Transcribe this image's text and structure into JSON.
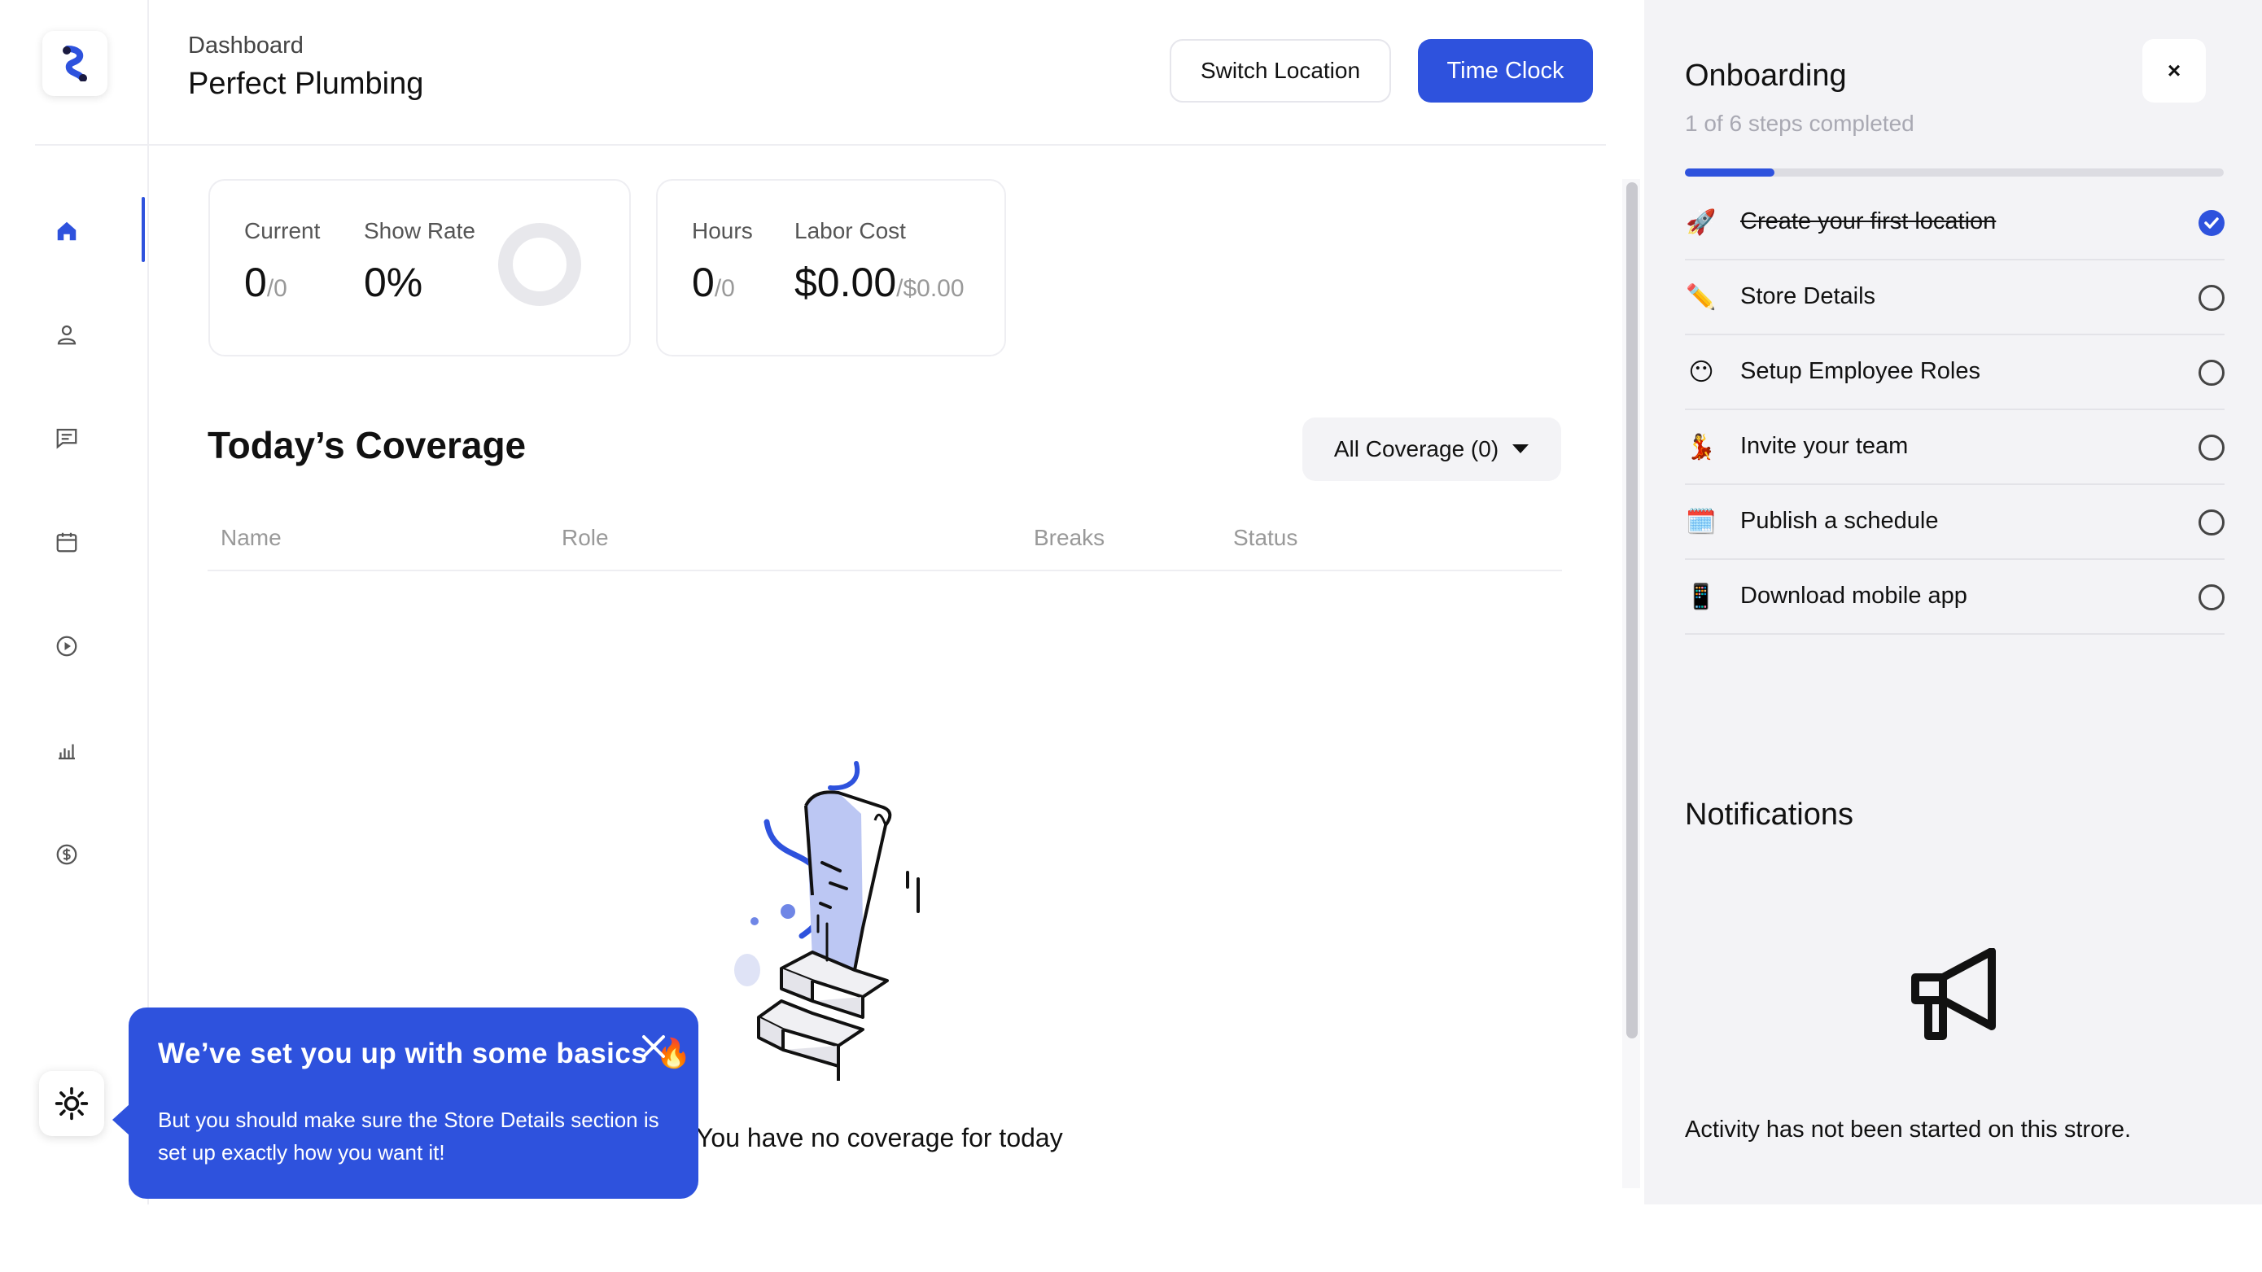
{
  "header": {
    "breadcrumb": "Dashboard",
    "title": "Perfect Plumbing",
    "switch_location": "Switch Location",
    "time_clock": "Time Clock"
  },
  "stats": {
    "current_label": "Current",
    "current_value": "0",
    "current_total": "/0",
    "show_rate_label": "Show Rate",
    "show_rate_value": "0%",
    "hours_label": "Hours",
    "hours_value": "0",
    "hours_total": "/0",
    "labor_label": "Labor Cost",
    "labor_value": "$0.00",
    "labor_total": "/$0.00"
  },
  "coverage": {
    "title": "Today’s Coverage",
    "filter": "All Coverage (0)",
    "columns": [
      "Name",
      "Role",
      "Breaks",
      "Status"
    ],
    "empty": "You have no coverage for today"
  },
  "tooltip": {
    "title": "We’ve set you up with some basics",
    "emoji": "🔥",
    "body": "But you should make sure the Store Details section is set up exactly how you want it!"
  },
  "onboarding": {
    "title": "Onboarding",
    "progress_text": "1 of 6 steps completed",
    "completed": 1,
    "total": 6,
    "close": "×",
    "steps": [
      {
        "emoji": "🚀",
        "label": "Create your first location",
        "done": true
      },
      {
        "emoji": "✏️",
        "label": "Store Details",
        "done": false
      },
      {
        "emoji": "😶",
        "label": "Setup Employee Roles",
        "done": false
      },
      {
        "emoji": "💃",
        "label": "Invite your team",
        "done": false
      },
      {
        "emoji": "🗓️",
        "label": "Publish a schedule",
        "done": false
      },
      {
        "emoji": "📱",
        "label": "Download mobile app",
        "done": false
      }
    ]
  },
  "notifications": {
    "title": "Notifications",
    "empty": "Activity has not been started on this strore."
  },
  "colors": {
    "accent": "#2e52dd",
    "panel_bg": "#f3f3f6"
  }
}
